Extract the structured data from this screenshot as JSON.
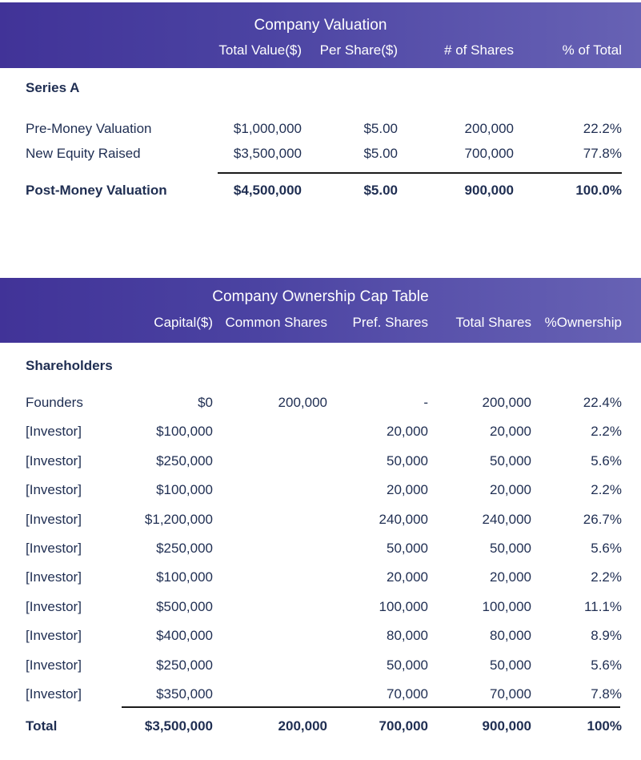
{
  "theme": {
    "header_gradient_start": "#413398",
    "header_gradient_end": "#6762b4",
    "header_text": "#ffffff",
    "body_text": "#1f2e52",
    "rule_color": "#1b1b1b",
    "page_background": "#ffffff"
  },
  "valuation_table": {
    "title": "Company Valuation",
    "columns": [
      "",
      "Total Value($)",
      "Per Share($)",
      "# of Shares",
      "% of Total"
    ],
    "section_label": "Series A",
    "rows": [
      {
        "label": "Pre-Money Valuation",
        "total_value": "$1,000,000",
        "per_share": "$5.00",
        "shares": "200,000",
        "pct": "22.2%"
      },
      {
        "label": "New Equity Raised",
        "total_value": "$3,500,000",
        "per_share": "$5.00",
        "shares": "700,000",
        "pct": "77.8%"
      }
    ],
    "total_row": {
      "label": "Post-Money Valuation",
      "total_value": "$4,500,000",
      "per_share": "$5.00",
      "shares": "900,000",
      "pct": "100.0%"
    }
  },
  "cap_table": {
    "title": "Company Ownership Cap Table",
    "columns": [
      "",
      "Capital($)",
      "Common Shares",
      "Pref. Shares",
      "Total Shares",
      "%Ownership"
    ],
    "section_label": "Shareholders",
    "rows": [
      {
        "holder": "Founders",
        "capital": "$0",
        "common": "200,000",
        "pref": "-",
        "total": "200,000",
        "ownership": "22.4%"
      },
      {
        "holder": "[Investor]",
        "capital": "$100,000",
        "common": "",
        "pref": "20,000",
        "total": "20,000",
        "ownership": "2.2%"
      },
      {
        "holder": "[Investor]",
        "capital": "$250,000",
        "common": "",
        "pref": "50,000",
        "total": "50,000",
        "ownership": "5.6%"
      },
      {
        "holder": "[Investor]",
        "capital": "$100,000",
        "common": "",
        "pref": "20,000",
        "total": "20,000",
        "ownership": "2.2%"
      },
      {
        "holder": "[Investor]",
        "capital": "$1,200,000",
        "common": "",
        "pref": "240,000",
        "total": "240,000",
        "ownership": "26.7%"
      },
      {
        "holder": "[Investor]",
        "capital": "$250,000",
        "common": "",
        "pref": "50,000",
        "total": "50,000",
        "ownership": "5.6%"
      },
      {
        "holder": "[Investor]",
        "capital": "$100,000",
        "common": "",
        "pref": "20,000",
        "total": "20,000",
        "ownership": "2.2%"
      },
      {
        "holder": "[Investor]",
        "capital": "$500,000",
        "common": "",
        "pref": "100,000",
        "total": "100,000",
        "ownership": "11.1%"
      },
      {
        "holder": "[Investor]",
        "capital": "$400,000",
        "common": "",
        "pref": "80,000",
        "total": "80,000",
        "ownership": "8.9%"
      },
      {
        "holder": "[Investor]",
        "capital": "$250,000",
        "common": "",
        "pref": "50,000",
        "total": "50,000",
        "ownership": "5.6%"
      },
      {
        "holder": "[Investor]",
        "capital": "$350,000",
        "common": "",
        "pref": "70,000",
        "total": "70,000",
        "ownership": "7.8%"
      }
    ],
    "total_row": {
      "holder": "Total",
      "capital": "$3,500,000",
      "common": "200,000",
      "pref": "700,000",
      "total": "900,000",
      "ownership": "100%"
    }
  }
}
